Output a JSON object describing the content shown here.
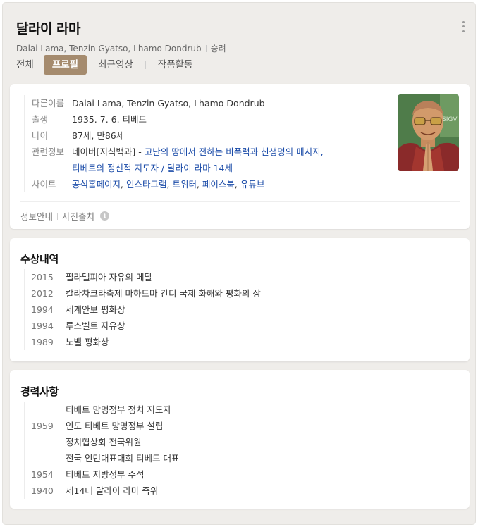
{
  "header": {
    "title": "달라이 라마",
    "aliases": "Dalai Lama, Tenzin Gyatso, Lhamo Dondrub",
    "occupation": "승려"
  },
  "tabs": [
    {
      "label": "전체",
      "active": false
    },
    {
      "label": "프로필",
      "active": true
    },
    {
      "label": "최근영상",
      "active": false
    },
    {
      "label": "작품활동",
      "active": false
    }
  ],
  "profile": {
    "other_names": {
      "label": "다른이름",
      "value": "Dalai Lama, Tenzin Gyatso, Lhamo Dondrub"
    },
    "birth": {
      "label": "출생",
      "value": "1935. 7. 6. 티베트"
    },
    "age": {
      "label": "나이",
      "value": "87세, 만86세"
    },
    "related": {
      "label": "관련정보",
      "source": "네이버[지식백과]",
      "dash": "-",
      "link1": "고난의 땅에서 전하는 비폭력과 친생명의 메시지,",
      "link2": "티베트의 정신적 지도자 / 달라이 라마 14세"
    },
    "site": {
      "label": "사이트",
      "links": [
        "공식홈페이지",
        "인스타그램",
        "트위터",
        "페이스북",
        "유튜브"
      ],
      "separator": ", "
    },
    "footer": {
      "info_label": "정보안내",
      "photo_source_label": "사진출처"
    }
  },
  "awards": {
    "title": "수상내역",
    "items": [
      {
        "year": "2015",
        "text": "필라델피아 자유의 메달"
      },
      {
        "year": "2012",
        "text": "칼라차크라축제 마하트마 간디 국제 화해와 평화의 상"
      },
      {
        "year": "1994",
        "text": "세계안보 평화상"
      },
      {
        "year": "1994",
        "text": "루스벨트 자유상"
      },
      {
        "year": "1989",
        "text": "노벨 평화상"
      }
    ]
  },
  "career": {
    "title": "경력사항",
    "items": [
      {
        "year": "",
        "text": "티베트 망명정부 정치 지도자"
      },
      {
        "year": "1959",
        "text": "인도 티베트 망명정부 설립"
      },
      {
        "year": "",
        "text": "정치협상회 전국위원"
      },
      {
        "year": "",
        "text": "전국 인민대표대회 티베트 대표"
      },
      {
        "year": "1954",
        "text": "티베트 지방정부 주석"
      },
      {
        "year": "1940",
        "text": "제14대 달라이 라마 즉위"
      }
    ]
  },
  "colors": {
    "tab_active_bg": "#a58b6e",
    "link": "#1a4ba8",
    "page_bg": "#efedea"
  },
  "icons": {
    "more": "vertical-dots-icon",
    "info": "info-circle-icon"
  }
}
